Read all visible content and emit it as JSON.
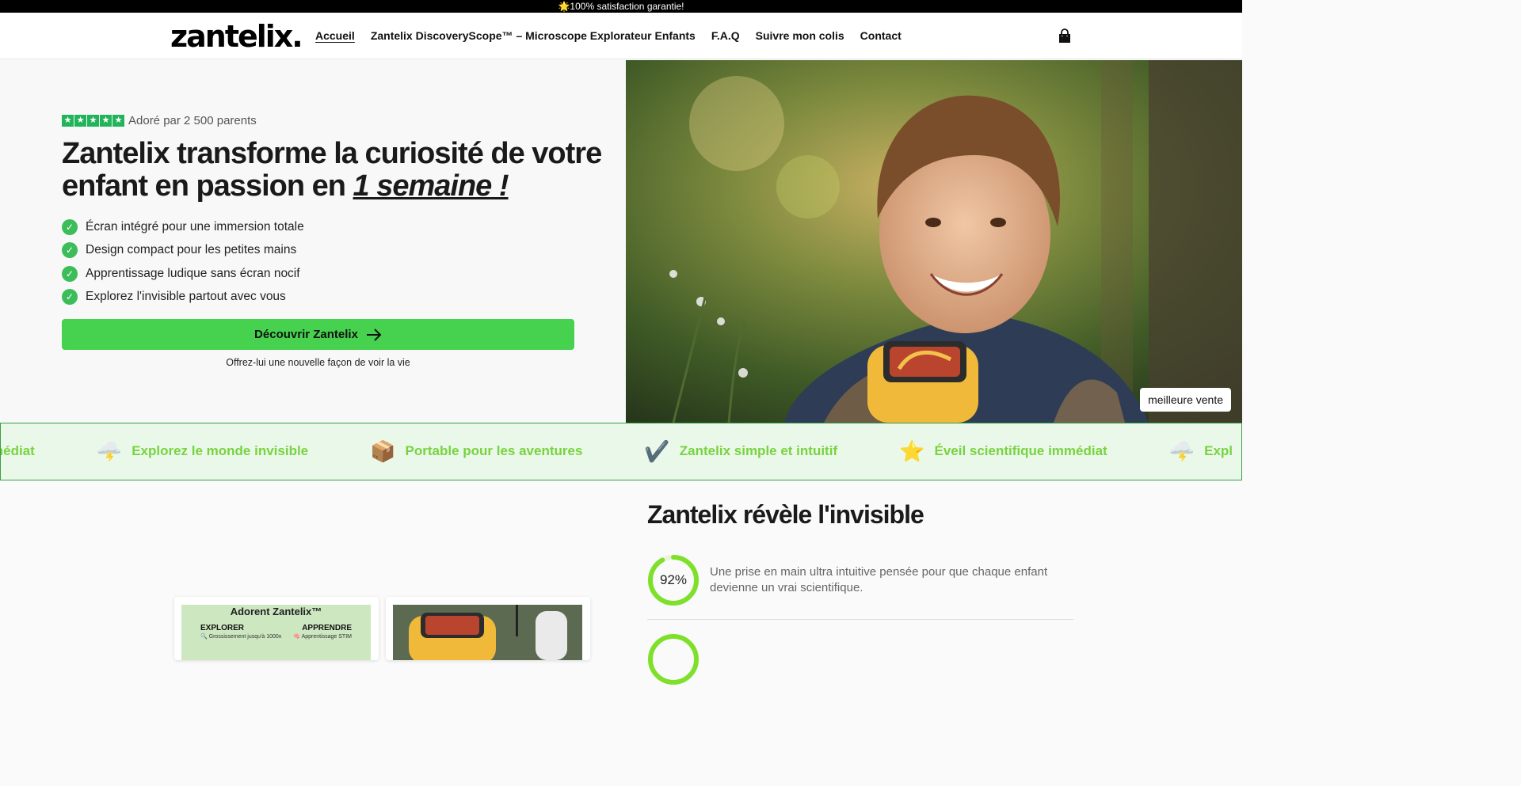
{
  "announcement": "🌟100% satisfaction garantie!",
  "header": {
    "logo": "zantelix.",
    "nav": [
      {
        "label": "Accueil",
        "active": true
      },
      {
        "label": "Zantelix DiscoveryScope™ – Microscope Explorateur Enfants",
        "active": false
      },
      {
        "label": "F.A.Q",
        "active": false
      },
      {
        "label": "Suivre mon colis",
        "active": false
      },
      {
        "label": "Contact",
        "active": false
      }
    ],
    "cart_icon": "shopping-bag-icon"
  },
  "hero": {
    "rating": {
      "stars": 5,
      "text": "Adoré par 2 500 parents"
    },
    "headline_main": "Zantelix transforme la curiosité de votre enfant en passion en ",
    "headline_em": "1 semaine !",
    "features": [
      "Écran intégré pour une immersion totale",
      "Design compact pour les petites mains",
      "Apprentissage ludique sans écran nocif",
      "Explorez l'invisible partout avec vous"
    ],
    "cta_label": "Découvrir Zantelix",
    "cta_sub": "Offrez-lui une nouvelle façon de voir la vie",
    "image_badge": "meilleure vente",
    "colors": {
      "accent": "#46d14e",
      "check": "#3dbd5a",
      "star": "#22b45a"
    }
  },
  "marquee": [
    {
      "icon": "",
      "text": "e immédiat"
    },
    {
      "icon": "🌩️",
      "text": "Explorez le monde invisible"
    },
    {
      "icon": "📦",
      "text": "Portable pour les aventures"
    },
    {
      "icon": "✔️",
      "text": "Zantelix simple et intuitif"
    },
    {
      "icon": "⭐",
      "text": "Éveil scientifique immédiat"
    },
    {
      "icon": "🌩️",
      "text": "Expl"
    }
  ],
  "section": {
    "title": "Zantelix révèle l'invisible",
    "stats": [
      {
        "value": "92%",
        "percent": 92,
        "text": "Une prise en main ultra intuitive pensée pour que chaque enfant devienne un vrai scientifique."
      }
    ],
    "card1": {
      "title": "Adorent Zantelix™",
      "col1": "EXPLORER",
      "col2": "APPRENDRE",
      "sub1": "🔍 Grossissement jusqu'à 1000x",
      "sub2": "🧠 Apprentissage STIM"
    }
  }
}
